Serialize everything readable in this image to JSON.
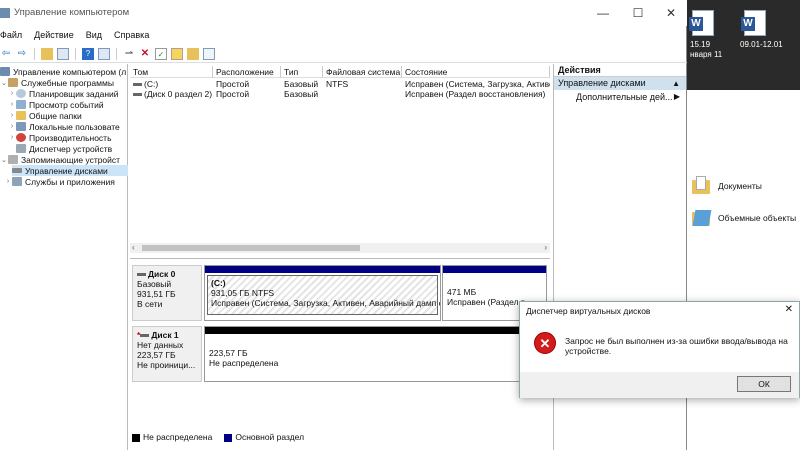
{
  "window": {
    "title": "Управление компьютером",
    "minimize": "—",
    "maximize": "☐",
    "close": "✕"
  },
  "menu": [
    "Файл",
    "Действие",
    "Вид",
    "Справка"
  ],
  "tree": {
    "items": [
      {
        "label": "Управление компьютером (л",
        "indent": 0,
        "arrow": ""
      },
      {
        "label": "Служебные программы",
        "indent": 1,
        "arrow": "v"
      },
      {
        "label": "Планировщик заданий",
        "indent": 2,
        "arrow": ">"
      },
      {
        "label": "Просмотр событий",
        "indent": 2,
        "arrow": ">"
      },
      {
        "label": "Общие папки",
        "indent": 2,
        "arrow": ">"
      },
      {
        "label": "Локальные пользовате",
        "indent": 2,
        "arrow": ">"
      },
      {
        "label": "Производительность",
        "indent": 2,
        "arrow": ">"
      },
      {
        "label": "Диспетчер устройств",
        "indent": 2,
        "arrow": ""
      },
      {
        "label": "Запоминающие устройст",
        "indent": 1,
        "arrow": "v"
      },
      {
        "label": "Управление дисками",
        "indent": 2,
        "arrow": ""
      },
      {
        "label": "Службы и приложения",
        "indent": 1,
        "arrow": ">"
      }
    ]
  },
  "list": {
    "columns": [
      "Том",
      "Расположение",
      "Тип",
      "Файловая система",
      "Состояние"
    ],
    "rows": [
      [
        "(C:)",
        "Простой",
        "Базовый",
        "NTFS",
        "Исправен (Система, Загрузка, Активе"
      ],
      [
        "(Диск 0 раздел 2)",
        "Простой",
        "Базовый",
        "",
        "Исправен (Раздел восстановления)"
      ]
    ]
  },
  "disks": [
    {
      "name": "Диск 0",
      "type": "Базовый",
      "size": "931,51 ГБ",
      "status": "В сети",
      "partitions": [
        {
          "label": "(C:)",
          "size": "931,05 ГБ NTFS",
          "status": "Исправен (Система, Загрузка, Активен, Аварийный дамп с"
        },
        {
          "label": "",
          "size": "471 МБ",
          "status": "Исправен (Раздел в"
        }
      ]
    },
    {
      "name": "Диск 1",
      "type": "Нет данных",
      "size": "223,57 ГБ",
      "status": "Не проиници...",
      "partitions": [
        {
          "label": "",
          "size": "223,57 ГБ",
          "status": "Не распределена"
        }
      ]
    }
  ],
  "legend": [
    {
      "label": "Не распределена",
      "color": "#000000"
    },
    {
      "label": "Основной раздел",
      "color": "#000080"
    }
  ],
  "actions": {
    "title": "Действия",
    "section": "Управление дисками",
    "more": "Дополнительные дей..."
  },
  "dialog": {
    "title": "Диспетчер виртуальных дисков",
    "close": "✕",
    "message": "Запрос не был выполнен из-за ошибки ввода/вывода на устройстве.",
    "ok": "ОК"
  },
  "desktop": {
    "item1_date": "15.19",
    "item1_sub": "нваря 11",
    "item2_date": "09.01-12.01",
    "folders": [
      "Документы",
      "Объемные объекты"
    ]
  },
  "colors": {
    "primary_partition": "#000080",
    "unallocated": "#000000",
    "selection": "#cce4f7",
    "error": "#d21b1b"
  }
}
